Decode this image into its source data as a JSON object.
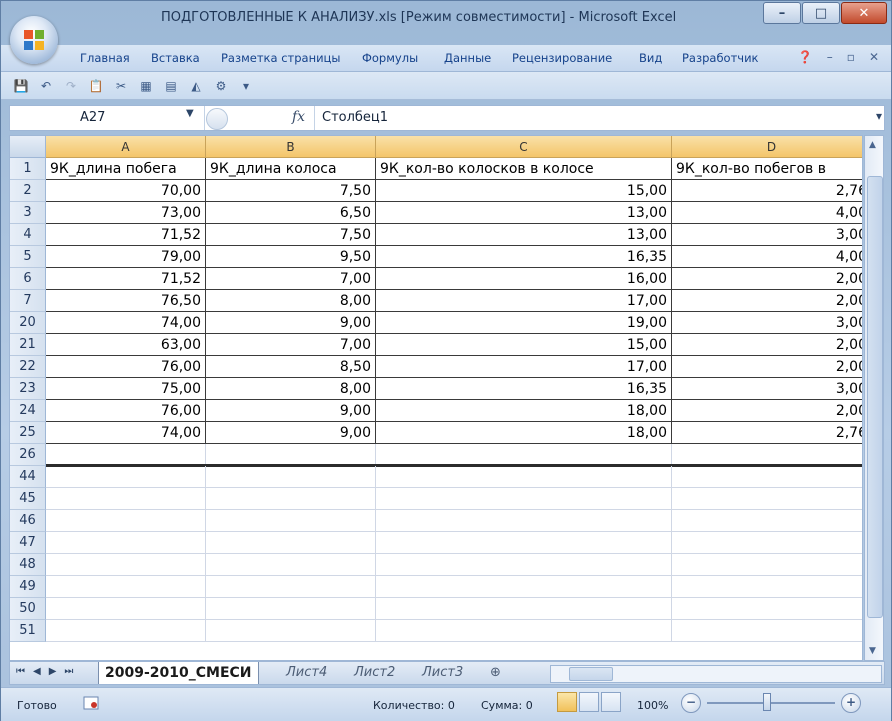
{
  "window": {
    "title": "ПОДГОТОВЛЕННЫЕ К АНАЛИЗУ.xls  [Режим совместимости] - Microsoft Excel"
  },
  "ribbon_tabs": [
    "Главная",
    "Вставка",
    "Разметка страницы",
    "Формулы",
    "Данные",
    "Рецензирование",
    "Вид",
    "Разработчик"
  ],
  "formula_bar": {
    "name_box": "A27",
    "fx_label": "fx",
    "value": "Столбец1"
  },
  "columns": [
    "A",
    "B",
    "C",
    "D"
  ],
  "header_row": {
    "row": "1",
    "cells": [
      "9К_длина побега",
      "9К_длина колоса",
      "9К_кол-во колосков в колосе",
      "9К_кол-во побегов  в"
    ]
  },
  "data_rows": [
    {
      "row": "2",
      "cells": [
        "70,00",
        "7,50",
        "15,00",
        "2,76"
      ]
    },
    {
      "row": "3",
      "cells": [
        "73,00",
        "6,50",
        "13,00",
        "4,00"
      ]
    },
    {
      "row": "4",
      "cells": [
        "71,52",
        "7,50",
        "13,00",
        "3,00"
      ]
    },
    {
      "row": "5",
      "cells": [
        "79,00",
        "9,50",
        "16,35",
        "4,00"
      ]
    },
    {
      "row": "6",
      "cells": [
        "71,52",
        "7,00",
        "16,00",
        "2,00"
      ]
    },
    {
      "row": "7",
      "cells": [
        "76,50",
        "8,00",
        "17,00",
        "2,00"
      ]
    },
    {
      "row": "20",
      "cells": [
        "74,00",
        "9,00",
        "19,00",
        "3,00"
      ]
    },
    {
      "row": "21",
      "cells": [
        "63,00",
        "7,00",
        "15,00",
        "2,00"
      ]
    },
    {
      "row": "22",
      "cells": [
        "76,00",
        "8,50",
        "17,00",
        "2,00"
      ]
    },
    {
      "row": "23",
      "cells": [
        "75,00",
        "8,00",
        "16,35",
        "3,00"
      ]
    },
    {
      "row": "24",
      "cells": [
        "76,00",
        "9,00",
        "18,00",
        "2,00"
      ]
    },
    {
      "row": "25",
      "cells": [
        "74,00",
        "9,00",
        "18,00",
        "2,76"
      ]
    }
  ],
  "empty_rows": [
    "26",
    "44",
    "45",
    "46",
    "47",
    "48",
    "49",
    "50",
    "51"
  ],
  "sheet_tabs": {
    "active": "2009-2010_СМЕСИ",
    "others": [
      "Лист4",
      "Лист2",
      "Лист3"
    ]
  },
  "status": {
    "ready": "Готово",
    "count": "Количество: 0",
    "sum": "Сумма: 0",
    "zoom": "100%"
  },
  "colors": {
    "column_header": "#f4c56a",
    "chrome": "#c5d7ee",
    "ribbon_text": "#15428b"
  }
}
